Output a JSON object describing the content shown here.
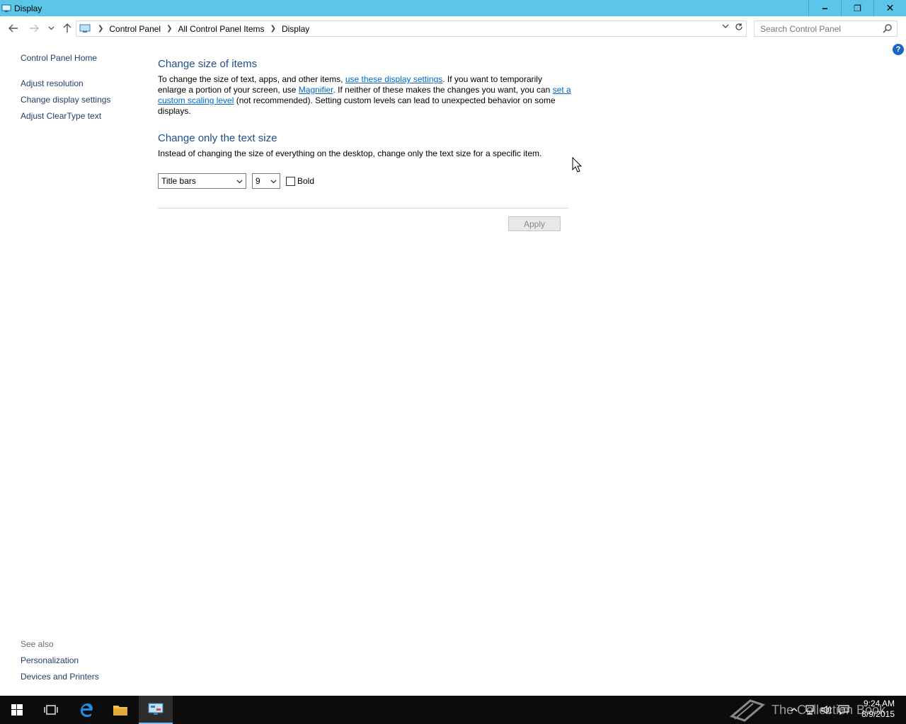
{
  "window": {
    "title": "Display",
    "minimize_label": "−",
    "restore_label": "❐",
    "close_label": "✕"
  },
  "nav": {
    "back_icon": "back-arrow-icon",
    "forward_icon": "forward-arrow-icon",
    "recent_icon": "chevron-down-icon",
    "up_icon": "up-arrow-icon",
    "breadcrumb": [
      "Control Panel",
      "All Control Panel Items",
      "Display"
    ],
    "search_placeholder": "Search Control Panel"
  },
  "sidebar": {
    "home": "Control Panel Home",
    "items": [
      "Adjust resolution",
      "Change display settings",
      "Adjust ClearType text"
    ],
    "see_also_title": "See also",
    "see_also": [
      "Personalization",
      "Devices and Printers"
    ]
  },
  "main": {
    "section1_title": "Change size of items",
    "section1_text_a": "To change the size of text, apps, and other items, ",
    "section1_link1": "use these display settings",
    "section1_text_b": ".  If you want to temporarily enlarge a portion of your screen, use ",
    "section1_link2": "Magnifier",
    "section1_text_c": ".  If neither of these makes the changes you want, you can ",
    "section1_link3": "set a custom scaling level",
    "section1_text_d": " (not recommended).  Setting custom levels can lead to unexpected behavior on some displays.",
    "section2_title": "Change only the text size",
    "section2_text": "Instead of changing the size of everything on the desktop, change only the text size for a specific item.",
    "item_select_value": "Title bars",
    "size_select_value": "9",
    "bold_label": "Bold",
    "bold_checked": false,
    "apply_label": "Apply",
    "help_label": "?"
  },
  "taskbar": {
    "time": "9:24 AM",
    "date": "8/9/2015",
    "watermark": "The Collection Book"
  },
  "colors": {
    "titlebar": "#5bc6e8",
    "heading": "#1e4e8c",
    "link": "#0066cc",
    "taskbar": "#0c0c0c"
  }
}
